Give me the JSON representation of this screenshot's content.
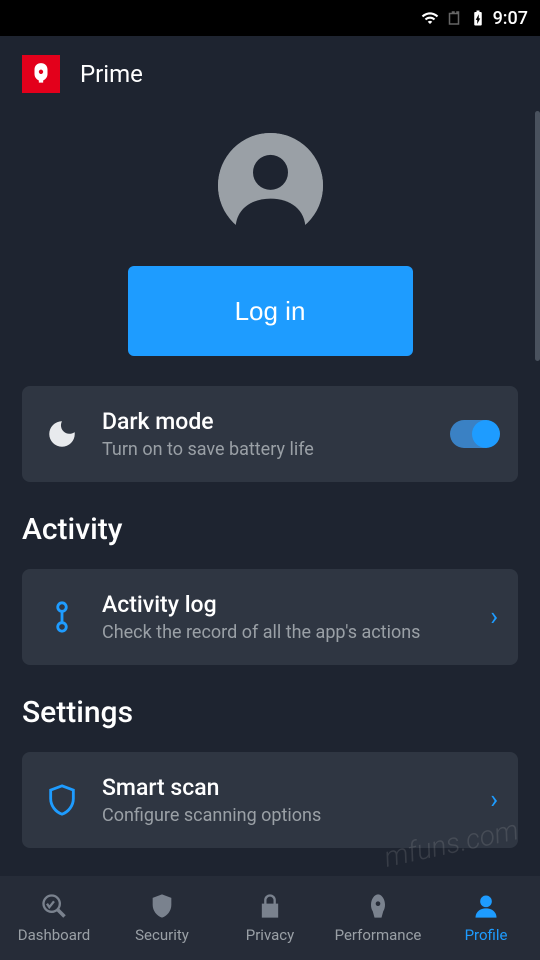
{
  "status": {
    "time": "9:07"
  },
  "header": {
    "title": "Prime"
  },
  "profile": {
    "login_label": "Log in"
  },
  "dark_mode": {
    "title": "Dark mode",
    "subtitle": "Turn on to save battery life",
    "enabled": true
  },
  "sections": {
    "activity": {
      "heading": "Activity",
      "items": [
        {
          "title": "Activity log",
          "subtitle": "Check the record of all the app's actions"
        }
      ]
    },
    "settings": {
      "heading": "Settings",
      "items": [
        {
          "title": "Smart scan",
          "subtitle": "Configure scanning options"
        }
      ]
    }
  },
  "nav": {
    "items": [
      {
        "label": "Dashboard"
      },
      {
        "label": "Security"
      },
      {
        "label": "Privacy"
      },
      {
        "label": "Performance"
      },
      {
        "label": "Profile"
      }
    ],
    "active_index": 4
  },
  "watermark": "mfuns.com"
}
